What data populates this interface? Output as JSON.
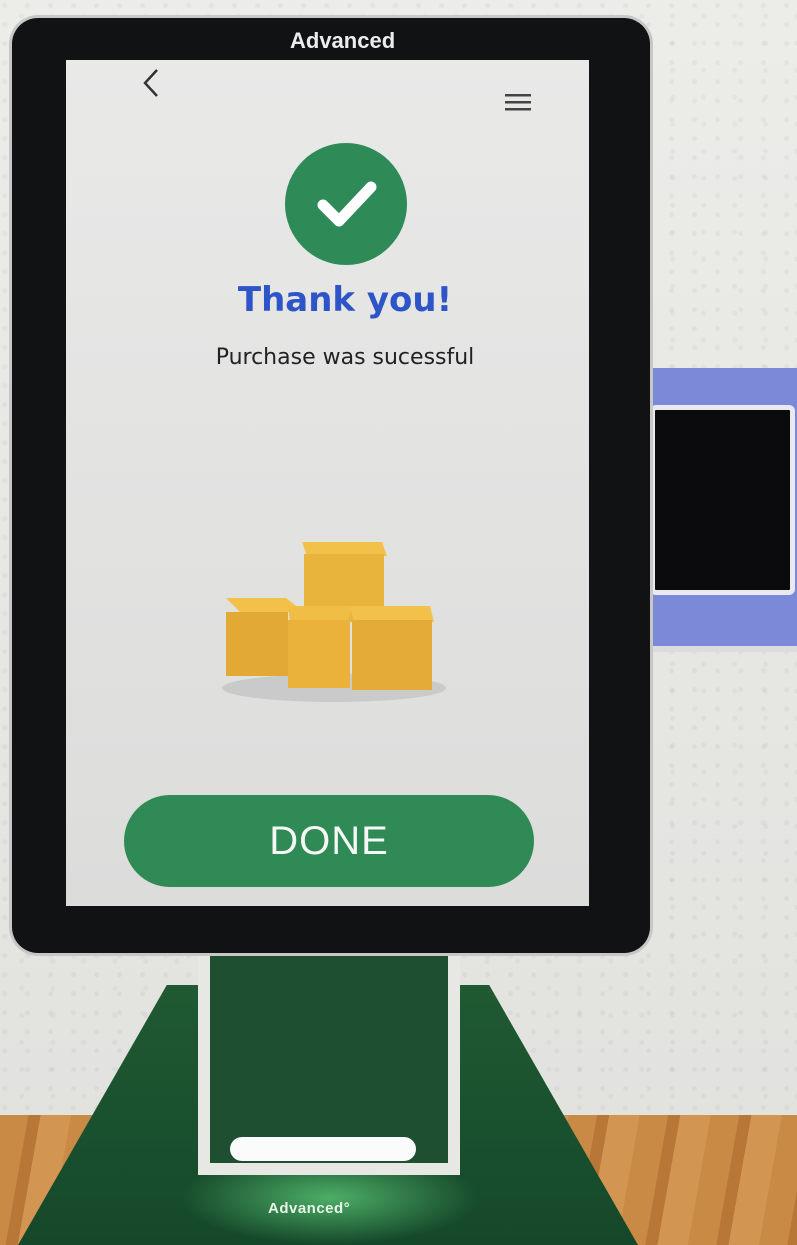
{
  "device": {
    "brand_top": "Advanced",
    "brand_base": "Advanced°"
  },
  "screen": {
    "back_icon": "chevron-left-icon",
    "menu_icon": "hamburger-menu-icon",
    "success_icon": "checkmark-icon",
    "title": "Thank you!",
    "subtitle": "Purchase was sucessful",
    "illustration": "stacked-boxes-icon",
    "done_label": "DONE",
    "colors": {
      "accent_green": "#2f8a55",
      "title_blue": "#2d55c8"
    }
  }
}
